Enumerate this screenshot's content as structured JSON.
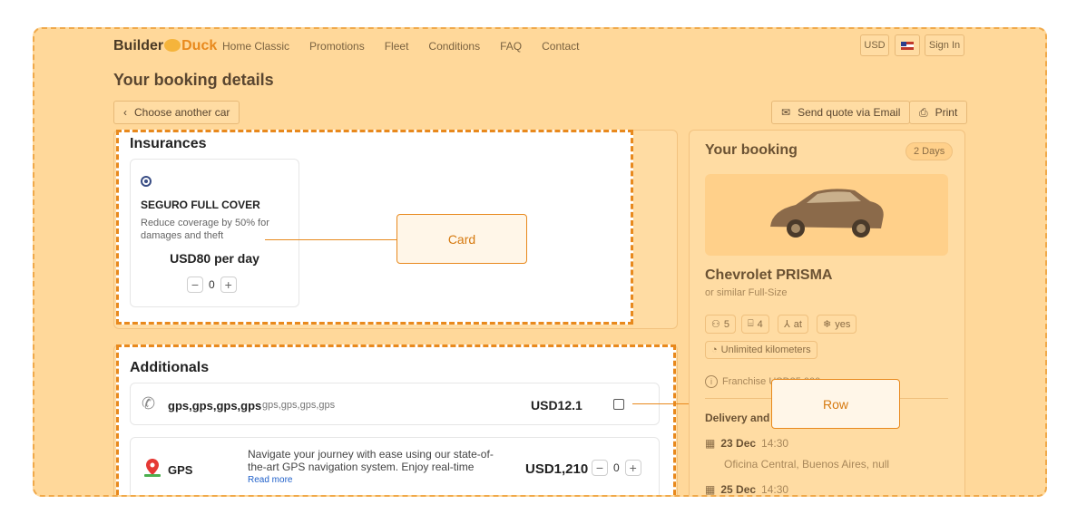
{
  "header": {
    "logo_builder": "Builder",
    "logo_duck": "Duck",
    "nav": [
      "Home Classic",
      "Promotions",
      "Fleet",
      "Conditions",
      "FAQ",
      "Contact"
    ],
    "currency": "USD",
    "sign_in": "Sign In"
  },
  "page_title": "Your booking details",
  "choose_another": "Choose another car",
  "send_quote": "Send quote via Email",
  "print": "Print",
  "insurances": {
    "title": "Insurances",
    "card": {
      "name": "SEGURO FULL COVER",
      "desc": "Reduce coverage by 50% for damages and theft",
      "price": "USD80 per day",
      "qty": "0"
    }
  },
  "additionals": {
    "title": "Additionals",
    "row1": {
      "name": "gps,gps,gps,gps",
      "sub": "gps,gps,gps,gps",
      "price": "USD12.1"
    },
    "row2": {
      "name": "GPS",
      "desc": "Navigate your journey with ease using our state-of-the-art GPS navigation system. Enjoy real-time",
      "read_more": "Read more",
      "price": "USD1,210",
      "qty": "0"
    }
  },
  "callouts": {
    "card": "Card",
    "row": "Row"
  },
  "booking": {
    "title": "Your booking",
    "days": "2 Days",
    "car_name": "Chevrolet PRISMA",
    "car_sub": "or similar Full-Size",
    "specs": {
      "seats": "5",
      "bags": "4",
      "trans": "at",
      "ac": "yes"
    },
    "km": "Unlimited kilometers",
    "franchise": "Franchise USD35,000",
    "delivery": "Delivery and r",
    "pickup_date": "23 Dec",
    "pickup_time": "14:30",
    "pickup_place": "Oficina Central, Buenos Aires, null",
    "return_date": "25 Dec",
    "return_time": "14:30"
  }
}
